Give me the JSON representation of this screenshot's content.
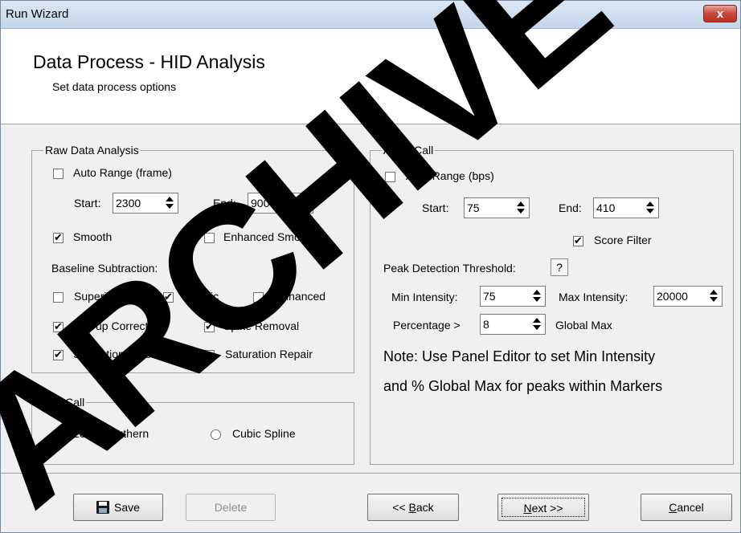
{
  "window": {
    "title": "Run Wizard",
    "close_glyph": "x"
  },
  "header": {
    "title": "Data Process - HID Analysis",
    "subtitle": "Set data process options"
  },
  "raw_data": {
    "legend": "Raw Data Analysis",
    "auto_range_label": "Auto Range (frame)",
    "auto_range_checked": false,
    "start_label": "Start:",
    "start_value": "2300",
    "end_label": "End:",
    "end_value": "9000",
    "smooth_label": "Smooth",
    "smooth_checked": true,
    "enhanced_smooth_label": "Enhanced Smooth",
    "enhanced_smooth_checked": false,
    "baseline_label": "Baseline Subtraction:",
    "superior_label": "Superior",
    "superior_checked": false,
    "classic_label": "Classic",
    "classic_checked": true,
    "enhanced_label": "Enhanced",
    "enhanced_checked": false,
    "pullup_label": "Pull-up Correction",
    "pullup_checked": true,
    "spike_label": "Spike Removal",
    "spike_checked": true,
    "sat_detect_label": "Saturation Detection",
    "sat_detect_checked": true,
    "sat_repair_label": "Saturation Repair",
    "sat_repair_checked": false
  },
  "size_call": {
    "legend": "Size Call",
    "local_southern_label": "Local Southern",
    "local_southern_selected": true,
    "cubic_spline_label": "Cubic Spline",
    "cubic_spline_selected": false
  },
  "allele_call": {
    "legend": "Allele Call",
    "auto_range_label": "Auto Range (bps)",
    "auto_range_checked": false,
    "start_label": "Start:",
    "start_value": "75",
    "end_label": "End:",
    "end_value": "410",
    "score_filter_label": "Score Filter",
    "score_filter_checked": true,
    "peak_threshold_label": "Peak Detection Threshold:",
    "help_glyph": "?",
    "min_intensity_label": "Min Intensity:",
    "min_intensity_value": "75",
    "max_intensity_label": "Max Intensity:",
    "max_intensity_value": "20000",
    "percentage_label": "Percentage >",
    "percentage_value": "8",
    "global_max_label": "Global Max",
    "note_line1": "Note: Use Panel Editor to set Min Intensity",
    "note_line2": "and % Global Max for peaks within Markers"
  },
  "buttons": {
    "save": "Save",
    "delete": "Delete",
    "back_prefix": "<< ",
    "back_ul": "B",
    "back_rest": "ack",
    "next_ul": "N",
    "next_rest": "ext >>",
    "cancel_ul": "C",
    "cancel_rest": "ancel"
  },
  "watermark": {
    "text": "ARCHIVE",
    "color": "#000000"
  }
}
